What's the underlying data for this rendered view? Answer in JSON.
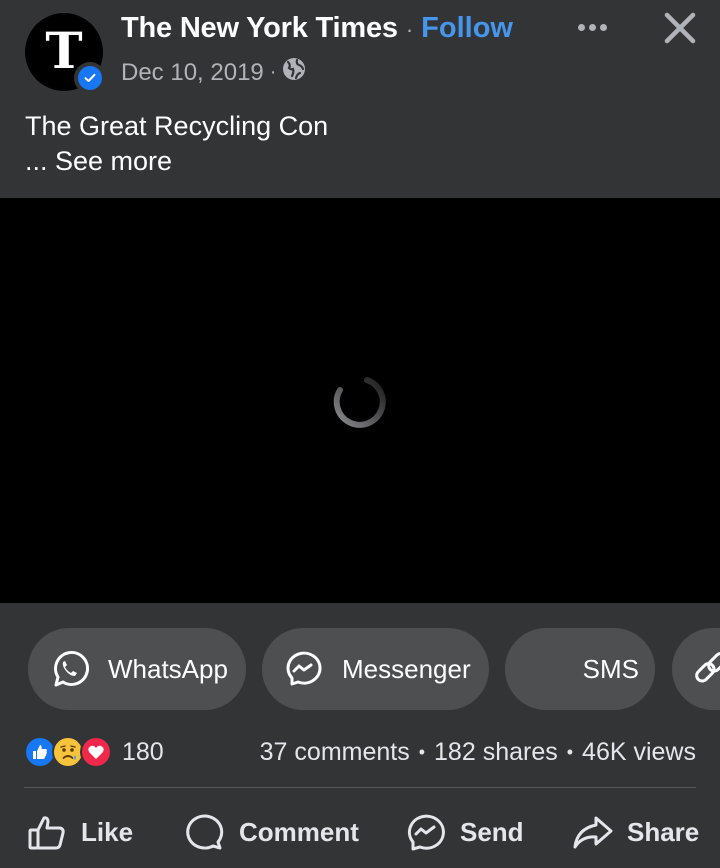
{
  "post": {
    "page_name": "The New York Times",
    "avatar_letter": "T",
    "verified": true,
    "follow_label": "Follow",
    "separator": "·",
    "date": "Dec 10, 2019",
    "audience_icon": "globe-icon",
    "caption": "The Great Recycling Con",
    "see_more_label": "... See more"
  },
  "video": {
    "state": "loading",
    "icon": "loading-spinner-icon"
  },
  "share_targets": [
    {
      "label": "WhatsApp",
      "icon": "whatsapp-icon"
    },
    {
      "label": "Messenger",
      "icon": "messenger-icon"
    },
    {
      "label": "SMS",
      "icon": ""
    },
    {
      "label": "",
      "icon": "link-icon"
    }
  ],
  "stats": {
    "reactions": [
      "like",
      "sad",
      "love"
    ],
    "reaction_count": "180",
    "comments": "37 comments",
    "shares": "182 shares",
    "views": "46K views",
    "separator": "•"
  },
  "actions": [
    {
      "label": "Like",
      "icon": "thumbs-up-icon"
    },
    {
      "label": "Comment",
      "icon": "comment-icon"
    },
    {
      "label": "Send",
      "icon": "messenger-icon"
    },
    {
      "label": "Share",
      "icon": "share-arrow-icon"
    }
  ],
  "colors": {
    "background": "#333436",
    "accent": "#4596ec",
    "pill": "#4e4f51",
    "video": "#000000"
  }
}
